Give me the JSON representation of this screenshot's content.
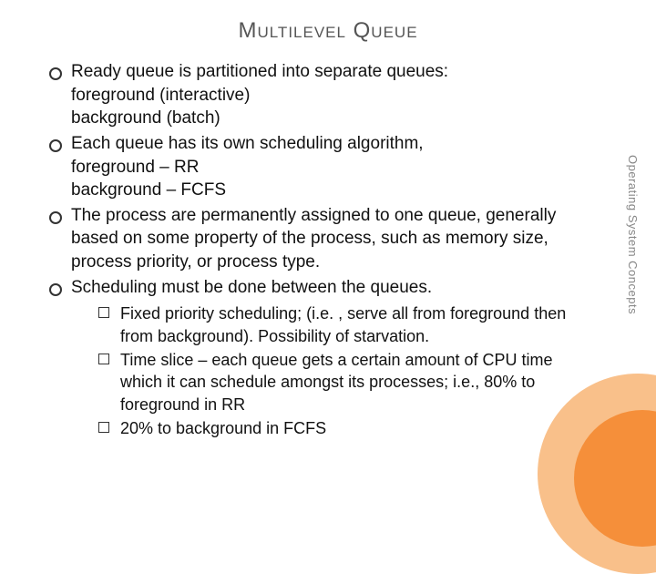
{
  "title": "Multilevel Queue",
  "bullets": [
    {
      "lines": [
        "Ready queue is partitioned into separate queues:",
        "foreground (interactive)",
        "background (batch)"
      ]
    },
    {
      "lines": [
        "Each queue has its own scheduling algorithm,",
        "foreground – RR",
        "background – FCFS"
      ]
    },
    {
      "lines": [
        "The process are permanently assigned to one queue, generally based on some property of the process, such as memory size, process priority, or process type."
      ]
    },
    {
      "lines": [
        "Scheduling must be done between the queues."
      ],
      "subs": [
        "Fixed priority scheduling; (i.e. , serve all from foreground then from background).  Possibility of starvation.",
        "Time slice – each queue gets a certain amount of CPU time which it can schedule amongst its processes; i.e., 80% to foreground in RR",
        "20% to background in FCFS"
      ]
    }
  ],
  "side_label": "Operating System Concepts"
}
